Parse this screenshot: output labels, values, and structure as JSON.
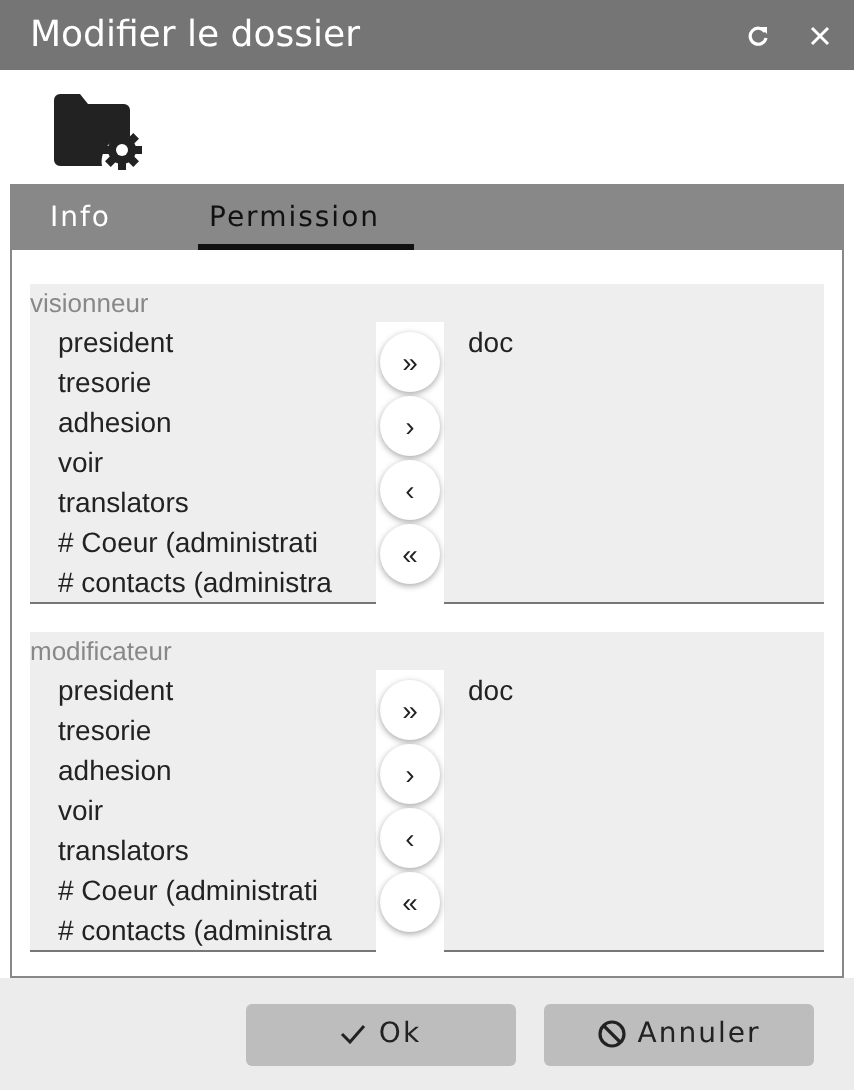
{
  "window": {
    "title": "Modifier le dossier"
  },
  "tabs": [
    {
      "label": "Info",
      "selected": false
    },
    {
      "label": "Permission",
      "selected": true
    }
  ],
  "sections": [
    {
      "label": "visionneur",
      "available": [
        "president",
        "tresorie",
        "adhesion",
        "voir",
        "translators",
        "# Coeur (administrati",
        "# contacts (administra"
      ],
      "buttons": [
        "»",
        "›",
        "‹",
        "«"
      ],
      "assigned": [
        "doc"
      ]
    },
    {
      "label": "modificateur",
      "available": [
        "president",
        "tresorie",
        "adhesion",
        "voir",
        "translators",
        "# Coeur (administrati",
        "# contacts (administra"
      ],
      "buttons": [
        "»",
        "›",
        "‹",
        "«"
      ],
      "assigned": [
        "doc"
      ]
    }
  ],
  "footer": [
    {
      "label": "Ok",
      "kind": "ok"
    },
    {
      "label": "Annuler",
      "kind": "cancel"
    }
  ]
}
